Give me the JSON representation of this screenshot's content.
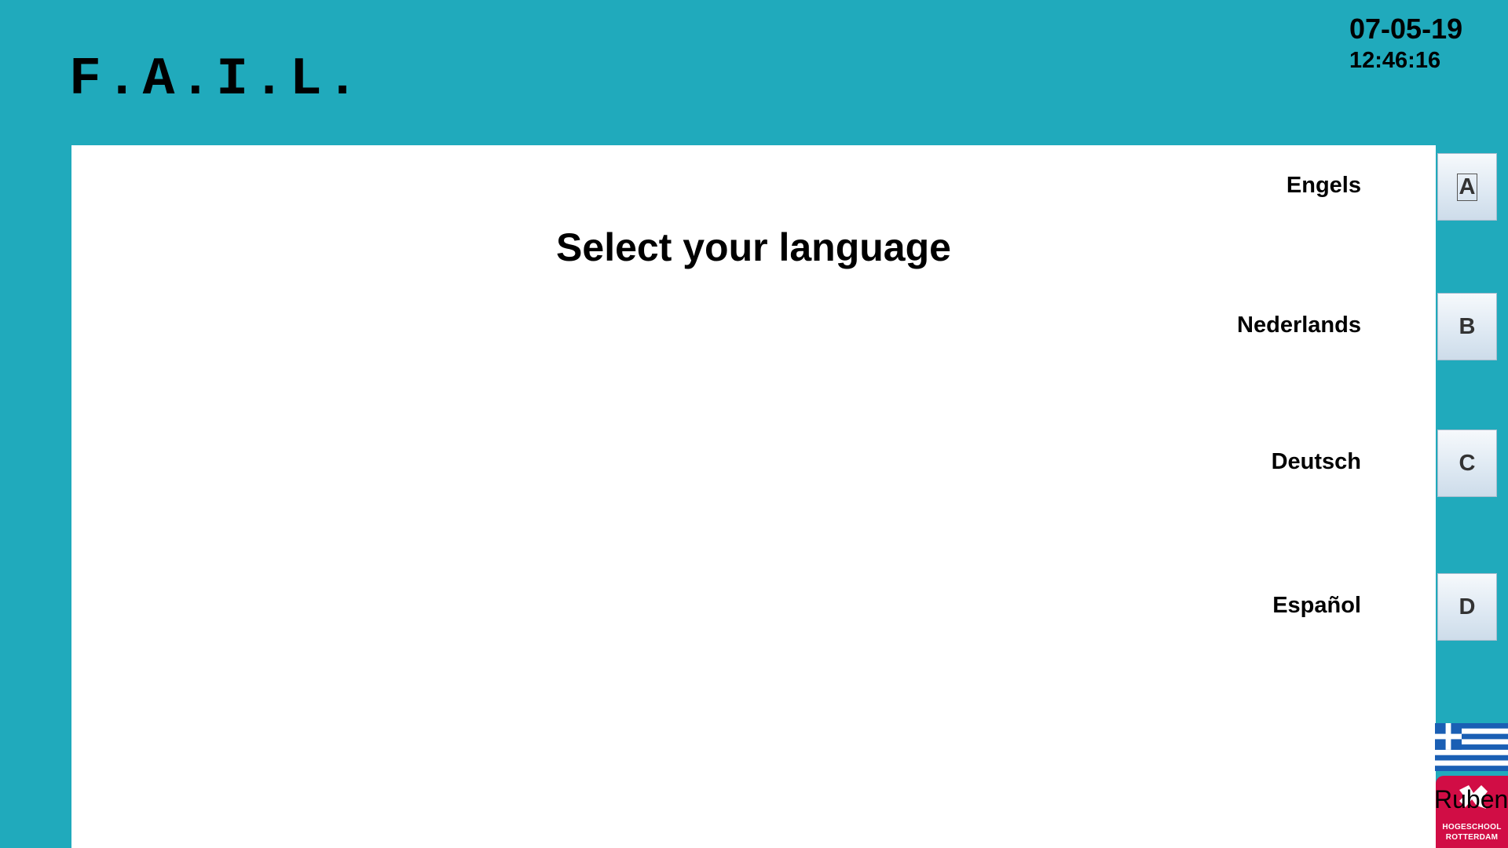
{
  "header": {
    "logo_text": "F.A.I.L.",
    "date": "07-05-19",
    "time": "12:46:16"
  },
  "main": {
    "prompt": "Select your language"
  },
  "languages": [
    {
      "label": "Engels",
      "key": "A"
    },
    {
      "label": "Nederlands",
      "key": "B"
    },
    {
      "label": "Deutsch",
      "key": "C"
    },
    {
      "label": "Español",
      "key": "D"
    }
  ],
  "footer": {
    "flag_icon": "greece-flag-icon",
    "user_name": "Ruben",
    "school_line1": "HOGESCHOOL",
    "school_line2": "ROTTERDAM"
  },
  "colors": {
    "background": "#20aabc",
    "panel": "#ffffff",
    "logo_red": "#d10d45",
    "flag_blue": "#1a5fb4"
  }
}
